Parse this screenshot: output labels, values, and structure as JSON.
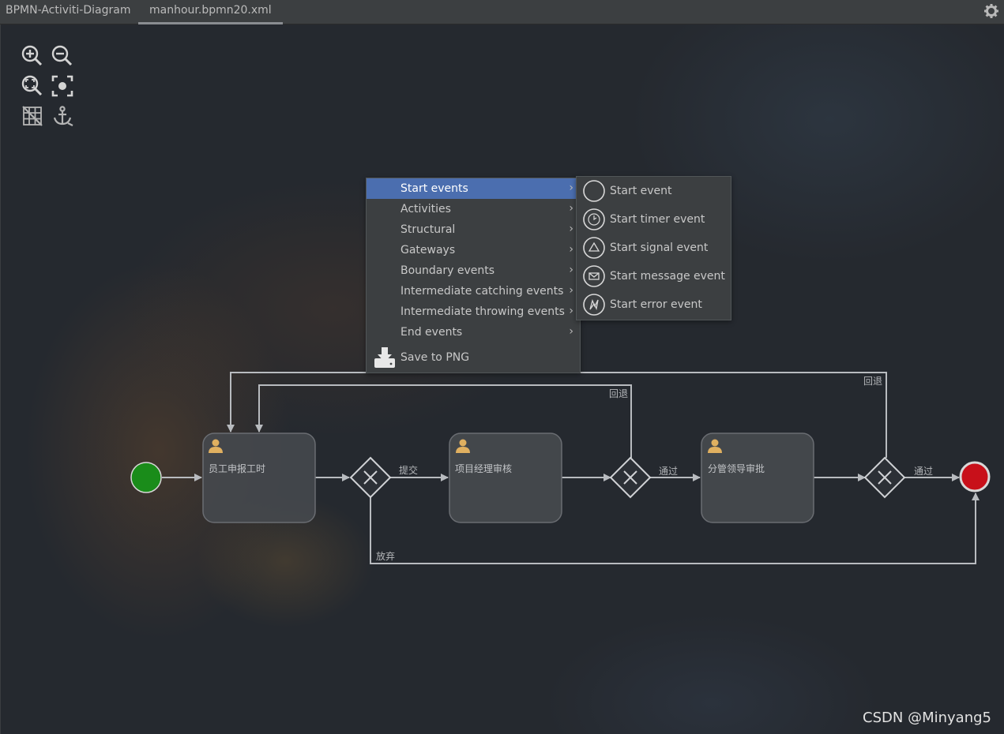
{
  "tabs": [
    {
      "label": "BPMN-Activiti-Diagram"
    },
    {
      "label": "manhour.bpmn20.xml"
    }
  ],
  "toolbar": {
    "icons": [
      "zoom-in-icon",
      "zoom-out-icon",
      "zoom-fit-icon",
      "zoom-actual-icon",
      "grid-toggle-icon",
      "anchor-icon"
    ]
  },
  "context_menu": {
    "items": [
      {
        "label": "Start events",
        "selected": true
      },
      {
        "label": "Activities"
      },
      {
        "label": "Structural"
      },
      {
        "label": "Gateways"
      },
      {
        "label": "Boundary events"
      },
      {
        "label": "Intermediate catching events"
      },
      {
        "label": "Intermediate throwing events"
      },
      {
        "label": "End events"
      }
    ],
    "save_label": "Save to PNG"
  },
  "submenu": {
    "items": [
      {
        "label": "Start event",
        "icon": "circle-icon"
      },
      {
        "label": "Start timer event",
        "icon": "timer-icon"
      },
      {
        "label": "Start signal event",
        "icon": "signal-icon"
      },
      {
        "label": "Start message event",
        "icon": "message-icon"
      },
      {
        "label": "Start error event",
        "icon": "error-icon"
      }
    ]
  },
  "diagram": {
    "tasks": [
      "员工申报工时",
      "项目经理审核",
      "分管领导审批"
    ],
    "flows": {
      "submit": "提交",
      "pass1": "通过",
      "pass2": "通过",
      "reject1": "回退",
      "reject2": "回退",
      "abandon": "放弃"
    },
    "colors": {
      "start_event": "#1a8c1a",
      "end_event": "#c8101a",
      "task_fill": "#474a4f",
      "line": "#b8bbbf",
      "user_icon": "#e0b060"
    }
  },
  "watermark": "CSDN @Minyang5",
  "colors": {
    "menu_bg": "#3c3f41",
    "menu_selected": "#4b6eaf"
  }
}
